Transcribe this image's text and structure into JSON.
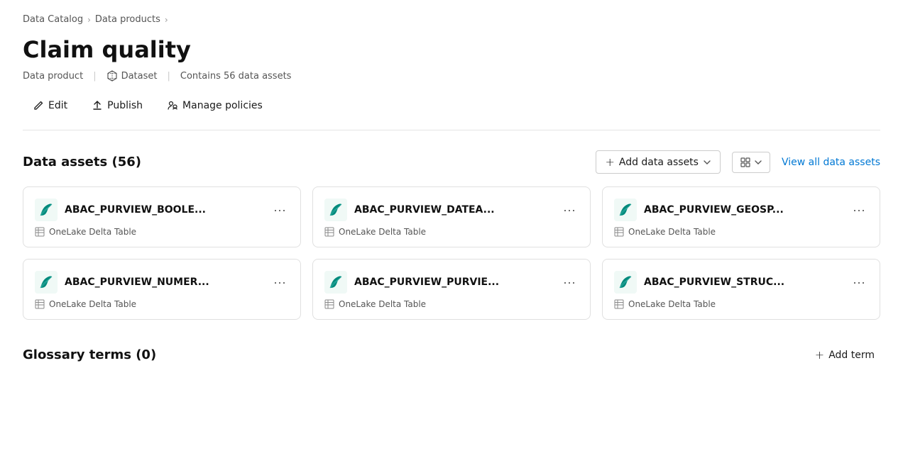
{
  "breadcrumb": {
    "items": [
      {
        "label": "Data Catalog",
        "href": "#"
      },
      {
        "label": "Data products",
        "href": "#"
      }
    ]
  },
  "page": {
    "title": "Claim quality",
    "meta_type": "Data product",
    "meta_dataset_label": "Dataset",
    "meta_assets": "Contains 56 data assets"
  },
  "actions": [
    {
      "id": "edit",
      "label": "Edit",
      "icon": "edit-icon"
    },
    {
      "id": "publish",
      "label": "Publish",
      "icon": "publish-icon"
    },
    {
      "id": "manage-policies",
      "label": "Manage policies",
      "icon": "policies-icon"
    }
  ],
  "data_assets_section": {
    "title": "Data assets (56)",
    "add_label": "Add data assets",
    "view_all_label": "View all data assets",
    "cards": [
      {
        "id": "card-1",
        "name": "ABAC_PURVIEW_BOOLE...",
        "type": "OneLake Delta Table"
      },
      {
        "id": "card-2",
        "name": "ABAC_PURVIEW_DATEA...",
        "type": "OneLake Delta Table"
      },
      {
        "id": "card-3",
        "name": "ABAC_PURVIEW_GEOSP...",
        "type": "OneLake Delta Table"
      },
      {
        "id": "card-4",
        "name": "ABAC_PURVIEW_NUMER...",
        "type": "OneLake Delta Table"
      },
      {
        "id": "card-5",
        "name": "ABAC_PURVIEW_PURVIE...",
        "type": "OneLake Delta Table"
      },
      {
        "id": "card-6",
        "name": "ABAC_PURVIEW_STRUC...",
        "type": "OneLake Delta Table"
      }
    ]
  },
  "glossary_section": {
    "title": "Glossary terms (0)",
    "add_term_label": "Add term"
  },
  "colors": {
    "link_blue": "#0078d4",
    "accent_teal": "#00897b"
  }
}
